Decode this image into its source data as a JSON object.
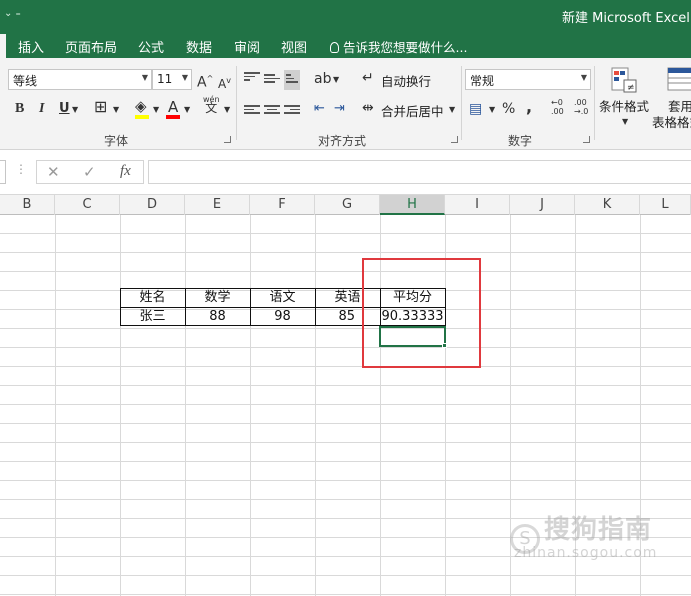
{
  "titlebar": {
    "quick_access": "⌄ ₌",
    "title": "新建 Microsoft Excel 工"
  },
  "tabs": [
    {
      "label": "插入"
    },
    {
      "label": "页面布局"
    },
    {
      "label": "公式"
    },
    {
      "label": "数据"
    },
    {
      "label": "审阅"
    },
    {
      "label": "视图"
    }
  ],
  "tell_me": "告诉我您想要做什么...",
  "ribbon": {
    "font_name": "等线",
    "font_size": "11",
    "grow_font": "A",
    "shrink_font": "A",
    "bold": "B",
    "italic": "I",
    "underline": "U",
    "font_color_letter": "A",
    "phonetic_top": "wén",
    "phonetic_bottom": "文",
    "font_group": "字体",
    "wrap_text": "自动换行",
    "merge_center": "合并后居中",
    "alignment_group": "对齐方式",
    "number_format": "常规",
    "percent": "%",
    "comma": ",",
    "inc_decimal_top": "←0",
    "inc_decimal_bottom": ".00",
    "dec_decimal_top": ".00",
    "dec_decimal_bottom": "→.0",
    "number_group": "数字",
    "conditional_format": "条件格式",
    "cell_style_top": "套用",
    "cell_style_bottom": "表格格式"
  },
  "formula_bar": {
    "fx": "fx",
    "cancel": "✕",
    "enter": "✓",
    "value": ""
  },
  "columns": [
    "B",
    "C",
    "D",
    "E",
    "F",
    "G",
    "H",
    "I",
    "J",
    "K",
    "L"
  ],
  "selected_column": "H",
  "table": {
    "headers": [
      "姓名",
      "数学",
      "语文",
      "英语",
      "平均分"
    ],
    "row": [
      "张三",
      "88",
      "98",
      "85",
      "90.33333"
    ]
  },
  "watermark": {
    "main": "搜狗指南",
    "sub": "zhinan.sogou.com"
  },
  "colors": {
    "excel_green": "#217346",
    "highlight_red": "#e0393e"
  }
}
